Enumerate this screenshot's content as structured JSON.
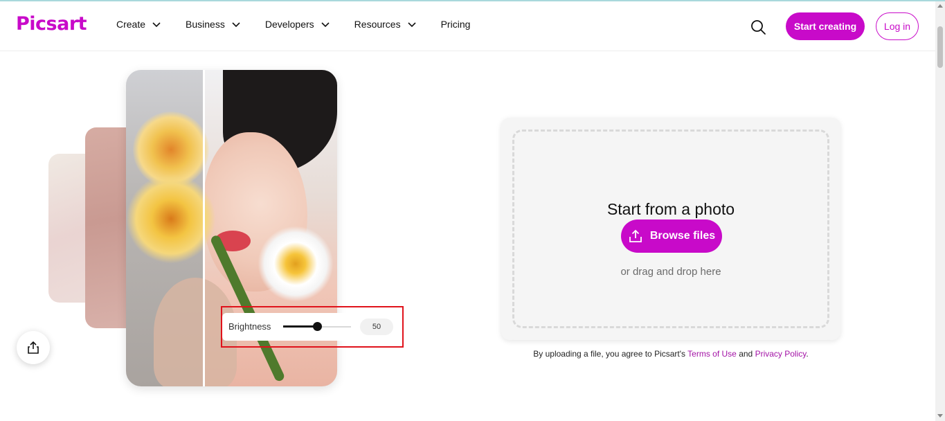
{
  "brand": {
    "logo_text": "Picsart",
    "accent": "#c80ac9"
  },
  "nav": {
    "items": [
      {
        "label": "Create",
        "has_dropdown": true
      },
      {
        "label": "Business",
        "has_dropdown": true
      },
      {
        "label": "Developers",
        "has_dropdown": true
      },
      {
        "label": "Resources",
        "has_dropdown": true
      },
      {
        "label": "Pricing",
        "has_dropdown": false
      }
    ]
  },
  "header": {
    "search_icon": "search-icon",
    "start_label": "Start creating",
    "login_label": "Log in"
  },
  "hero": {
    "brightness_label": "Brightness",
    "brightness_value": "50",
    "brightness_fraction": 0.5
  },
  "upload": {
    "title": "Start from a photo",
    "browse_label": "Browse files",
    "drag_text": "or drag and drop here"
  },
  "terms": {
    "prefix": "By uploading a file, you agree to Picsart's",
    "terms_link": "Terms of Use",
    "and": "and",
    "privacy_link": "Privacy Policy",
    "suffix": "."
  }
}
